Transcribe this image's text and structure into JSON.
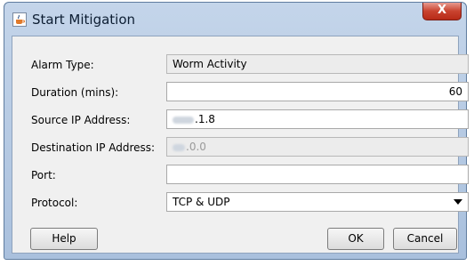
{
  "window": {
    "title": "Start Mitigation",
    "close_glyph": "X"
  },
  "form": {
    "alarm_type": {
      "label": "Alarm Type:",
      "value": "Worm Activity"
    },
    "duration": {
      "label": "Duration (mins):",
      "value": "60"
    },
    "source_ip": {
      "label": "Source IP Address:",
      "value": ".1.8"
    },
    "destination_ip": {
      "label": "Destination IP Address:",
      "value": ".0.0"
    },
    "port": {
      "label": "Port:",
      "value": ""
    },
    "protocol": {
      "label": "Protocol:",
      "value": "TCP & UDP"
    }
  },
  "buttons": {
    "help": "Help",
    "ok": "OK",
    "cancel": "Cancel"
  },
  "colors": {
    "title_bar": "#b7cbe5",
    "close_button": "#c9432f",
    "dialog_bg": "#f0f0f0"
  },
  "icons": {
    "window_icon": "java-cup-icon",
    "close": "close-icon",
    "dropdown": "chevron-down-icon"
  }
}
